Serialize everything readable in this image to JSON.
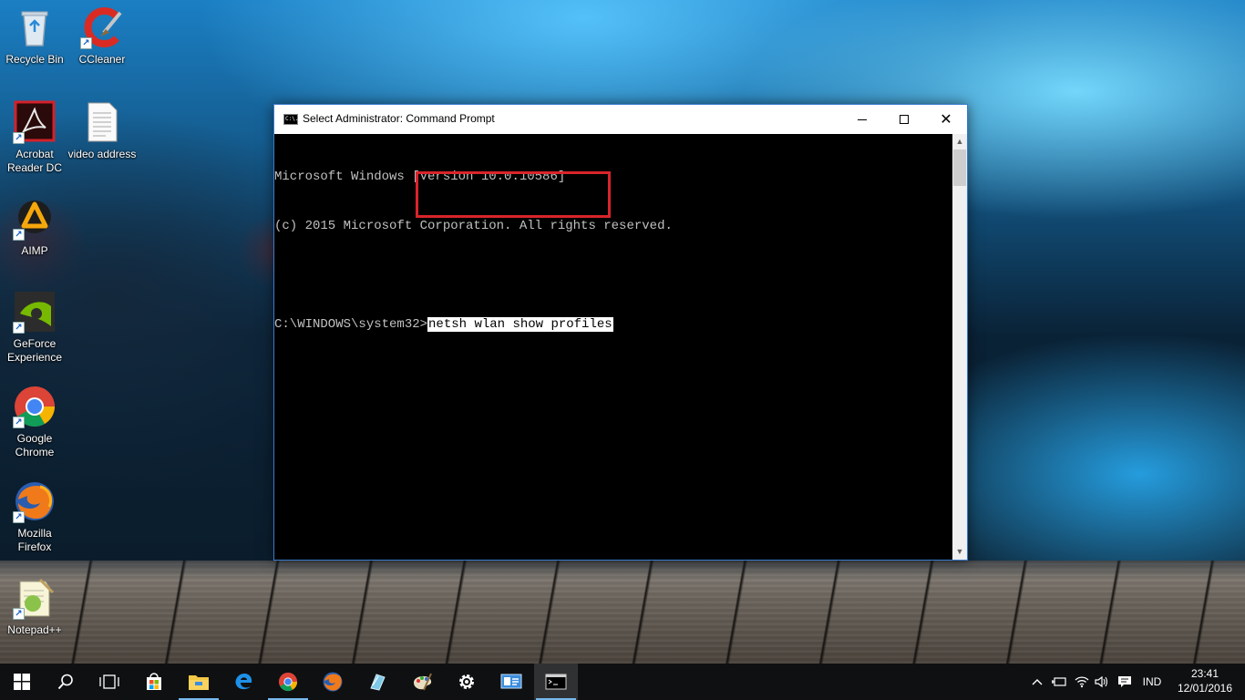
{
  "desktop": {
    "icons": [
      {
        "label": "Recycle Bin",
        "icon": "recycle-bin-icon"
      },
      {
        "label": "CCleaner",
        "icon": "ccleaner-icon"
      },
      {
        "label": "Acrobat Reader DC",
        "icon": "acrobat-reader-icon"
      },
      {
        "label": "video address",
        "icon": "text-file-icon"
      },
      {
        "label": "AIMP",
        "icon": "aimp-icon"
      },
      {
        "label": "GeForce Experience",
        "icon": "geforce-experience-icon"
      },
      {
        "label": "Google Chrome",
        "icon": "chrome-icon"
      },
      {
        "label": "Mozilla Firefox",
        "icon": "firefox-icon"
      },
      {
        "label": "Notepad++",
        "icon": "notepad-plus-plus-icon"
      }
    ]
  },
  "window": {
    "title": "Select Administrator: Command Prompt",
    "icon_text": "C:\\.",
    "close_symbol": "✕",
    "lines": [
      "Microsoft Windows [Version 10.0.10586]",
      "(c) 2015 Microsoft Corporation. All rights reserved.",
      ""
    ],
    "prompt": "C:\\WINDOWS\\system32>",
    "command": "netsh wlan show profiles",
    "highlight_color": "#d8242b"
  },
  "taskbar": {
    "items": [
      {
        "name": "start",
        "icon": "windows-logo-icon"
      },
      {
        "name": "search",
        "icon": "search-icon"
      },
      {
        "name": "task-view",
        "icon": "task-view-icon"
      },
      {
        "name": "store",
        "icon": "store-icon"
      },
      {
        "name": "file-explorer",
        "icon": "folder-icon"
      },
      {
        "name": "edge",
        "icon": "edge-icon"
      },
      {
        "name": "chrome",
        "icon": "chrome-icon"
      },
      {
        "name": "firefox",
        "icon": "firefox-icon"
      },
      {
        "name": "app-blue",
        "icon": "app-icon"
      },
      {
        "name": "paint",
        "icon": "paint-palette-icon"
      },
      {
        "name": "settings",
        "icon": "gear-icon"
      },
      {
        "name": "control-panel",
        "icon": "control-panel-icon"
      },
      {
        "name": "command-prompt",
        "icon": "command-prompt-icon"
      }
    ],
    "tray": {
      "language": "IND",
      "time": "23:41",
      "date": "12/01/2016"
    },
    "accent": "#76b9ed"
  }
}
